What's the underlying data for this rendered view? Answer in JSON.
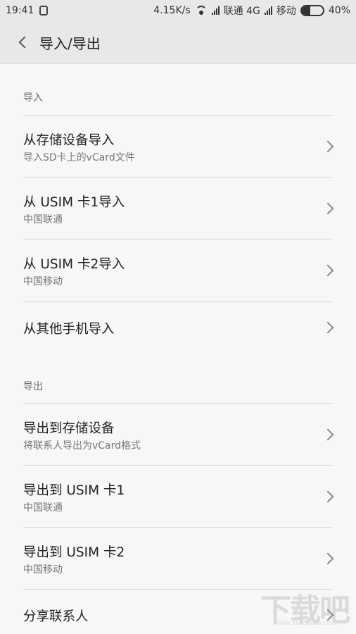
{
  "status_bar": {
    "time": "19:41",
    "speed": "4.15K/s",
    "carrier1": "联通 4G",
    "carrier2": "移动",
    "battery": "40%",
    "battery_level": 0.4
  },
  "header": {
    "title": "导入/导出"
  },
  "import_section": {
    "label": "导入",
    "items": [
      {
        "title": "从存储设备导入",
        "subtitle": "导入SD卡上的vCard文件"
      },
      {
        "title": "从 USIM 卡1导入",
        "subtitle": "中国联通"
      },
      {
        "title": "从 USIM 卡2导入",
        "subtitle": "中国移动"
      },
      {
        "title": "从其他手机导入",
        "subtitle": ""
      }
    ]
  },
  "export_section": {
    "label": "导出",
    "items": [
      {
        "title": "导出到存储设备",
        "subtitle": "将联系人导出为vCard格式"
      },
      {
        "title": "导出到 USIM 卡1",
        "subtitle": "中国联通"
      },
      {
        "title": "导出到 USIM 卡2",
        "subtitle": "中国移动"
      },
      {
        "title": "分享联系人",
        "subtitle": ""
      }
    ]
  },
  "watermark": {
    "text": "下载吧",
    "url": "www.xiazaiba.com"
  }
}
